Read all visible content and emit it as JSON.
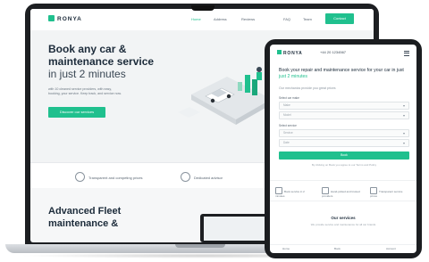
{
  "laptop": {
    "logo": "RONYA",
    "nav": [
      "Home",
      "Address",
      "Reviews",
      "FAQ",
      "Team"
    ],
    "contact_button": "Contact",
    "hero": {
      "title_line1": "Book any car &",
      "title_line2": "maintenance service",
      "title_line3": "in just 2 minutes",
      "text": "with 10 cleaned service providers, with easy, booking, your service. Keep track, and service now.",
      "cta": "Discover our services"
    },
    "features": [
      "Transparent and competing prices",
      "Dedicated advisor"
    ],
    "fleet_title_line1": "Advanced Fleet",
    "fleet_title_line2": "maintenance &"
  },
  "tablet": {
    "logo": "RONYA",
    "phone": "+44 20 1234567",
    "heading_pre": "Book your ",
    "heading_mid": "repair and maintenance service",
    "heading_post": " for your car in just",
    "heading_green": "just 2 minutes",
    "sub": "Our mechanics provide you great prices",
    "labels": [
      "Select car make",
      "Select service"
    ],
    "fields": [
      "Make",
      "Model",
      "Service",
      "Date"
    ],
    "button": "Book",
    "note": "By clicking on Book you agree to our Terms and Policy",
    "features": [
      "Book service in 2 minutes",
      "Hand-picked and trusted providers",
      "Transparent service prices"
    ],
    "services_title": "Our services",
    "services_sub": "We provide service and maintenance for all car brands",
    "bottom": [
      "Home",
      "Book",
      "Account"
    ]
  },
  "colors": {
    "accent": "#20c08e",
    "dark": "#1c2b3a",
    "device": "#1d1f22"
  }
}
